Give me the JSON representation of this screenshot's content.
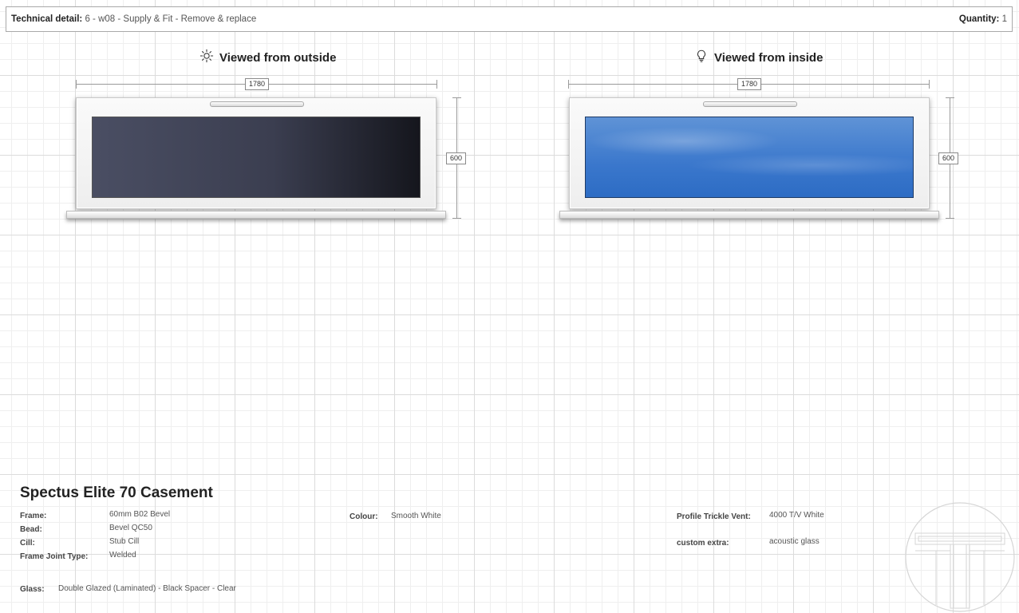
{
  "header": {
    "technical_label": "Technical detail:",
    "technical_value": "6 - w08 - Supply & Fit - Remove & replace",
    "quantity_label": "Quantity:",
    "quantity_value": "1"
  },
  "views": {
    "outside": {
      "title": "Viewed from outside",
      "icon": "sun-icon",
      "width": "1780",
      "height": "600"
    },
    "inside": {
      "title": "Viewed from inside",
      "icon": "lightbulb-icon",
      "width": "1780",
      "height": "600"
    }
  },
  "product": {
    "name": "Spectus Elite 70 Casement",
    "frame_label": "Frame:",
    "frame_value": "60mm B02 Bevel",
    "bead_label": "Bead:",
    "bead_value": "Bevel QC50",
    "cill_label": "Cill:",
    "cill_value": "Stub Cill",
    "joint_label": "Frame Joint Type:",
    "joint_value": "Welded",
    "glass_label": "Glass:",
    "glass_value": "Double Glazed (Laminated) - Black Spacer - Clear",
    "colour_label": "Colour:",
    "colour_value": "Smooth White",
    "vent_label": "Profile Trickle Vent:",
    "vent_value": "4000 T/V White",
    "extra_label": "custom extra:",
    "extra_value": "acoustic glass"
  },
  "colors": {
    "glass_outside": "#3b3e50",
    "glass_inside": "#3a77cc",
    "frame": "#f4f4f4"
  }
}
